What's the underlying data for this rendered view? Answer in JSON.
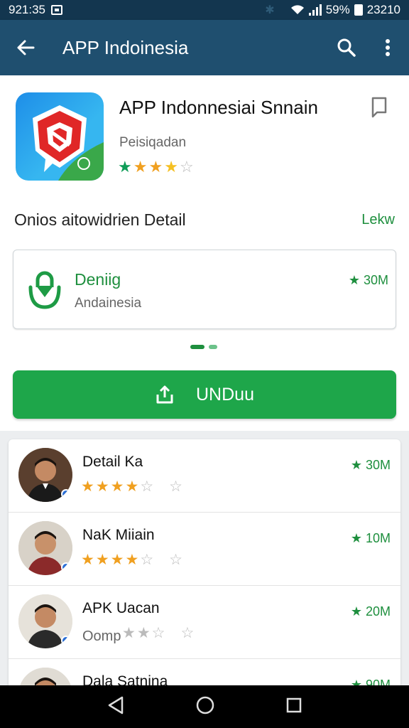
{
  "status_bar": {
    "left_text": "921:35",
    "battery_pct": "59%",
    "time": "23210"
  },
  "app_bar": {
    "title": "APP Indoinesia"
  },
  "app": {
    "name": "APP Indonnesiai Snnain",
    "publisher": "Peisiqadan",
    "rating": 3.5
  },
  "section": {
    "title": "Onios aitowidrien Detail",
    "link": "Lekw"
  },
  "detail_card": {
    "title": "Deniig",
    "subtitle": "Andainesia",
    "count": "★ 30M"
  },
  "download_button": {
    "label": "UNDuu"
  },
  "list": [
    {
      "name": "Detail Ka",
      "count": "★ 30M",
      "rating": 4,
      "subtitle": ""
    },
    {
      "name": "NaK Miiain",
      "count": "★ 10M",
      "rating": 4,
      "subtitle": ""
    },
    {
      "name": "APK Uacan",
      "count": "★ 20M",
      "rating": 0,
      "subtitle": "Oomp"
    },
    {
      "name": "Dala Satnina",
      "count": "★ 90M",
      "rating": 0,
      "subtitle": ""
    }
  ],
  "colors": {
    "status_bar": "#13364f",
    "app_bar": "#1f4f6f",
    "accent_green": "#1ea64a",
    "star": "#f0a020"
  }
}
